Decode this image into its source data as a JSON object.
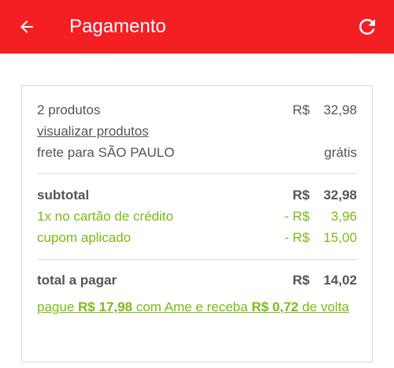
{
  "header": {
    "title": "Pagamento",
    "background_color": "#f41f25",
    "back_icon": "arrow-left-icon",
    "refresh_icon": "refresh-icon"
  },
  "summary": {
    "products": {
      "label": "2 produtos",
      "currency": "R$",
      "amount": "32,98"
    },
    "view_products_link": "visualizar produtos",
    "shipping": {
      "label": "frete para SÃO PAULO",
      "value": "grátis"
    },
    "subtotal": {
      "label": "subtotal",
      "currency": "R$",
      "amount": "32,98"
    },
    "credit_card": {
      "label": "1x no cartão de crédito",
      "currency": "- R$",
      "amount": "3,96"
    },
    "coupon": {
      "label": "cupom aplicado",
      "currency": "- R$",
      "amount": "15,00"
    },
    "total": {
      "label": "total a pagar",
      "currency": "R$",
      "amount": "14,02"
    }
  },
  "promo": {
    "prefix": "pague ",
    "pay_amount": "R$ 17,98",
    "middle": " com Ame e receba ",
    "cashback_amount": "R$ 0,72",
    "suffix": " de volta",
    "color": "#7cbb14"
  }
}
